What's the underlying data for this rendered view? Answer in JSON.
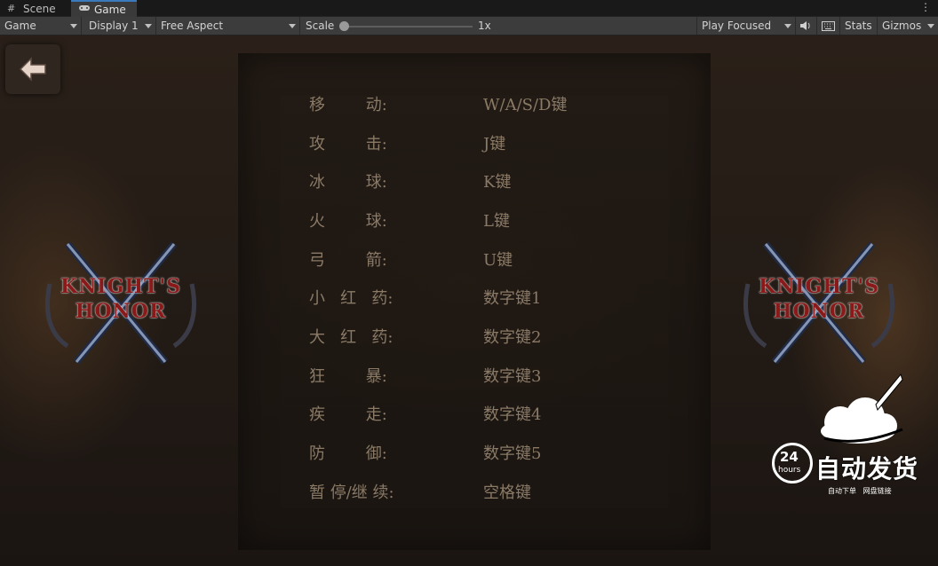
{
  "tabs": [
    {
      "label": "Scene",
      "icon": "grid-icon"
    },
    {
      "label": "Game",
      "icon": "gamepad-icon"
    }
  ],
  "toolbar": {
    "view_label": "Game",
    "display_label": "Display 1",
    "aspect_label": "Free Aspect",
    "scale_label": "Scale",
    "scale_value": "1x",
    "scale_fraction": 0.0,
    "play_mode_label": "Play Focused",
    "stats_label": "Stats",
    "gizmos_label": "Gizmos"
  },
  "game": {
    "logo": {
      "line1": "KNIGHT'S",
      "line2": "HONOR"
    },
    "controls": [
      {
        "action": "移        动:",
        "key": "W/A/S/D键"
      },
      {
        "action": "攻        击:",
        "key": " J键"
      },
      {
        "action": "冰        球:",
        "key": "K键"
      },
      {
        "action": "火        球:",
        "key": "L键"
      },
      {
        "action": "弓        箭:",
        "key": "U键"
      },
      {
        "action": "小   红   药:",
        "key": "数字键1"
      },
      {
        "action": "大   红   药:",
        "key": "数字键2"
      },
      {
        "action": "狂        暴:",
        "key": "数字键3"
      },
      {
        "action": "疾        走:",
        "key": "数字键4"
      },
      {
        "action": "防        御:",
        "key": "数字键5"
      },
      {
        "action": "暂 停/继 续:",
        "key": "空格键"
      }
    ],
    "watermark": {
      "number": "24",
      "unit": "hours",
      "title": "自动发货",
      "subtitle": "自动下单   网盘链接"
    }
  },
  "colors": {
    "accent": "#3a79bb",
    "text_dim": "#8a7a66",
    "logo_red": "#8a1a1a"
  }
}
